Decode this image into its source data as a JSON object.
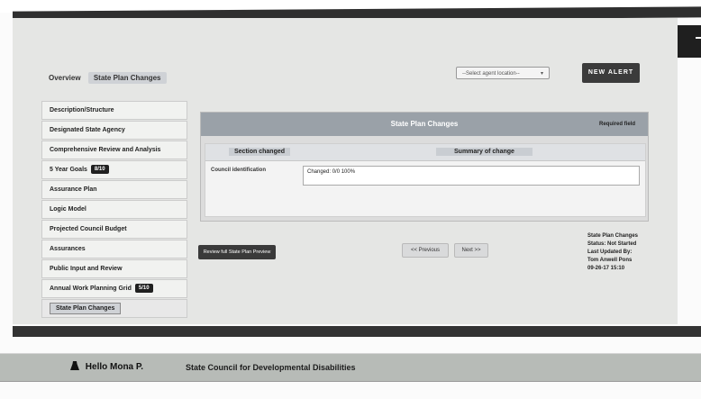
{
  "breadcrumb": {
    "root": "Overview",
    "current": "State Plan Changes"
  },
  "select": {
    "value": "--Select agent location--",
    "caret": "▾"
  },
  "header": {
    "submit_label": "NEW ALERT"
  },
  "sidebar": {
    "items": [
      {
        "label": "Description/Structure"
      },
      {
        "label": "Designated State Agency"
      },
      {
        "label": "Comprehensive Review and Analysis"
      },
      {
        "label": "5 Year Goals",
        "badge": "8/10"
      },
      {
        "label": "Assurance Plan"
      },
      {
        "label": "Logic Model"
      },
      {
        "label": "Projected Council Budget"
      },
      {
        "label": "Assurances"
      },
      {
        "label": "Public Input and Review"
      },
      {
        "label": "Annual Work Planning Grid",
        "badge": "5/10"
      },
      {
        "label": "State Plan Changes"
      }
    ]
  },
  "panel": {
    "title": "State Plan Changes",
    "subtitle": "Required field",
    "col_left": "Section changed",
    "col_right": "Summary of change",
    "row_label": "Council identification",
    "row_value": "Changed: 0/0 100%"
  },
  "buttons": {
    "view": "Review full State Plan Preview",
    "prev": "<< Previous",
    "next": "Next >>"
  },
  "status": {
    "line1": "State Plan Changes",
    "line2": "Status: Not Started",
    "line3": "Last Updated By:",
    "line4": "Tom Anwell Pons",
    "line5": "09-26-17 15:10"
  },
  "footer": {
    "user": "Hello Mona P.",
    "org": "State Council for Developmental Disabilities"
  }
}
